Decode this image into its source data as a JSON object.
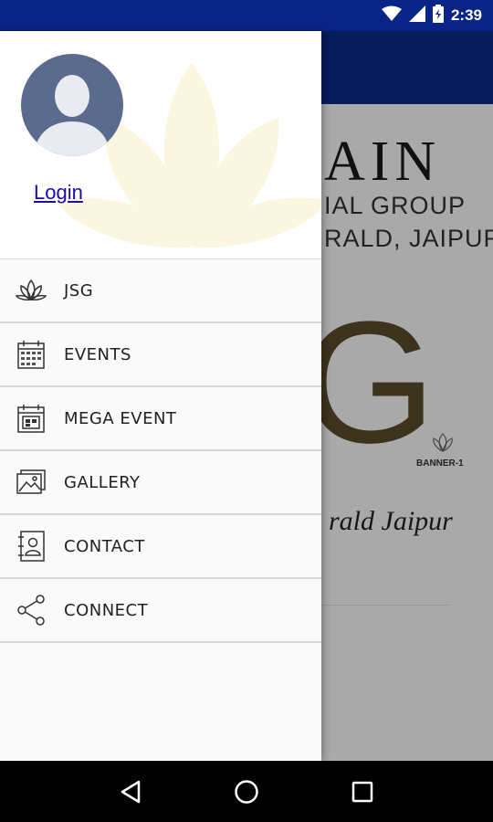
{
  "status_bar": {
    "time": "2:39",
    "icons": [
      "wifi-icon",
      "signal-icon",
      "battery-icon"
    ]
  },
  "banner": {
    "title": "AIN",
    "line1": "IAL GROUP",
    "line2": "RALD, JAIPUR",
    "big_letter": "G",
    "tag": "BANNER-1",
    "script": "rald Jaipur"
  },
  "drawer": {
    "login_label": "Login",
    "menu": [
      {
        "label": "JSG",
        "icon": "lotus-icon"
      },
      {
        "label": "EVENTS",
        "icon": "calendar-icon"
      },
      {
        "label": "MEGA EVENT",
        "icon": "calendar-event-icon"
      },
      {
        "label": "GALLERY",
        "icon": "gallery-icon"
      },
      {
        "label": "CONTACT",
        "icon": "contact-icon"
      },
      {
        "label": "CONNECT",
        "icon": "share-icon"
      }
    ]
  },
  "nav_bar": {
    "buttons": [
      "back-icon",
      "home-icon",
      "recents-icon"
    ]
  },
  "colors": {
    "status_bar": "#0a2386",
    "toolbar": "#0a2a8a",
    "link": "#1a0dab",
    "avatar_bg": "#5b6b8d"
  }
}
